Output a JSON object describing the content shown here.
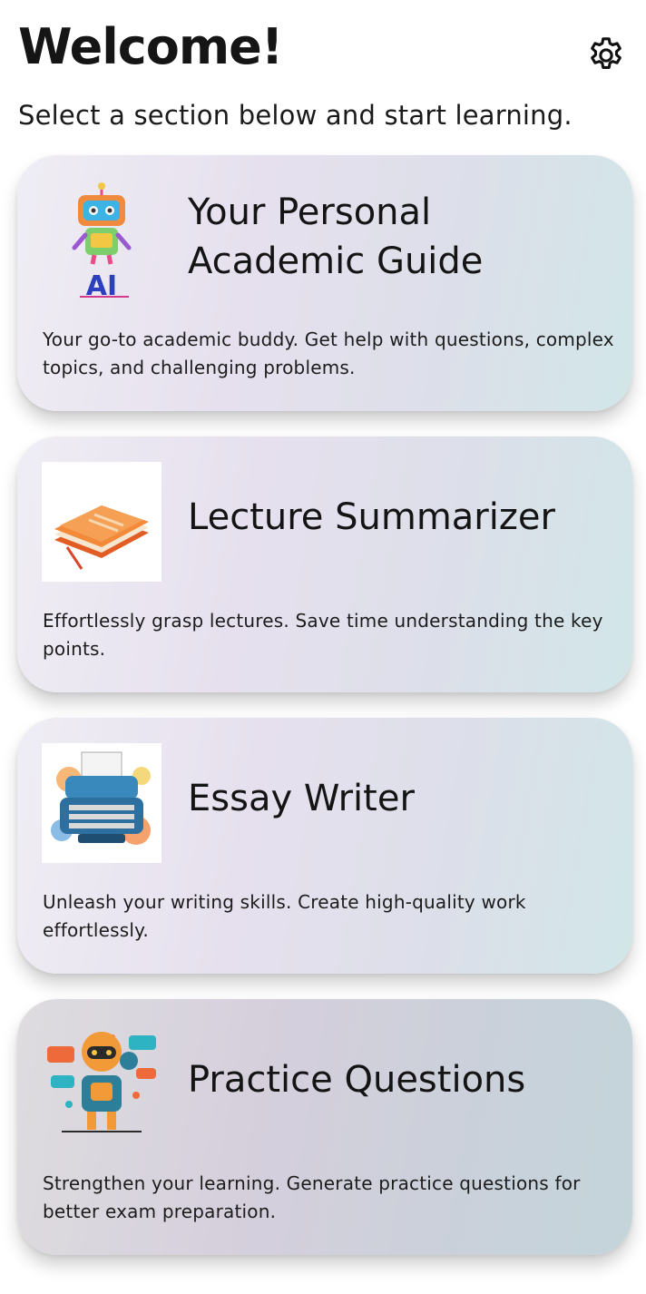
{
  "header": {
    "title": "Welcome!",
    "subtitle": "Select a section below and start learning.",
    "settings_icon": "gear-icon"
  },
  "cards": [
    {
      "title": "Your Personal Academic Guide",
      "description": "Your go-to academic buddy. Get help with questions, complex topics, and challenging problems.",
      "image": "robot-ai-illustration",
      "image_text": "AI"
    },
    {
      "title": "Lecture Summarizer",
      "description": "Effortlessly grasp lectures. Save time understanding the key points.",
      "image": "notebook-illustration"
    },
    {
      "title": "Essay Writer",
      "description": "Unleash your writing skills. Create high-quality work effortlessly.",
      "image": "typewriter-illustration"
    },
    {
      "title": "Practice Questions",
      "description": "Strengthen your learning. Generate practice questions for better exam preparation.",
      "image": "robot-chat-illustration"
    }
  ],
  "colors": {
    "card_gradient_start": "#efedf4",
    "card_gradient_mid": "#e6e0ee",
    "card_gradient_end": "#d1e6e8",
    "text": "#161616"
  }
}
